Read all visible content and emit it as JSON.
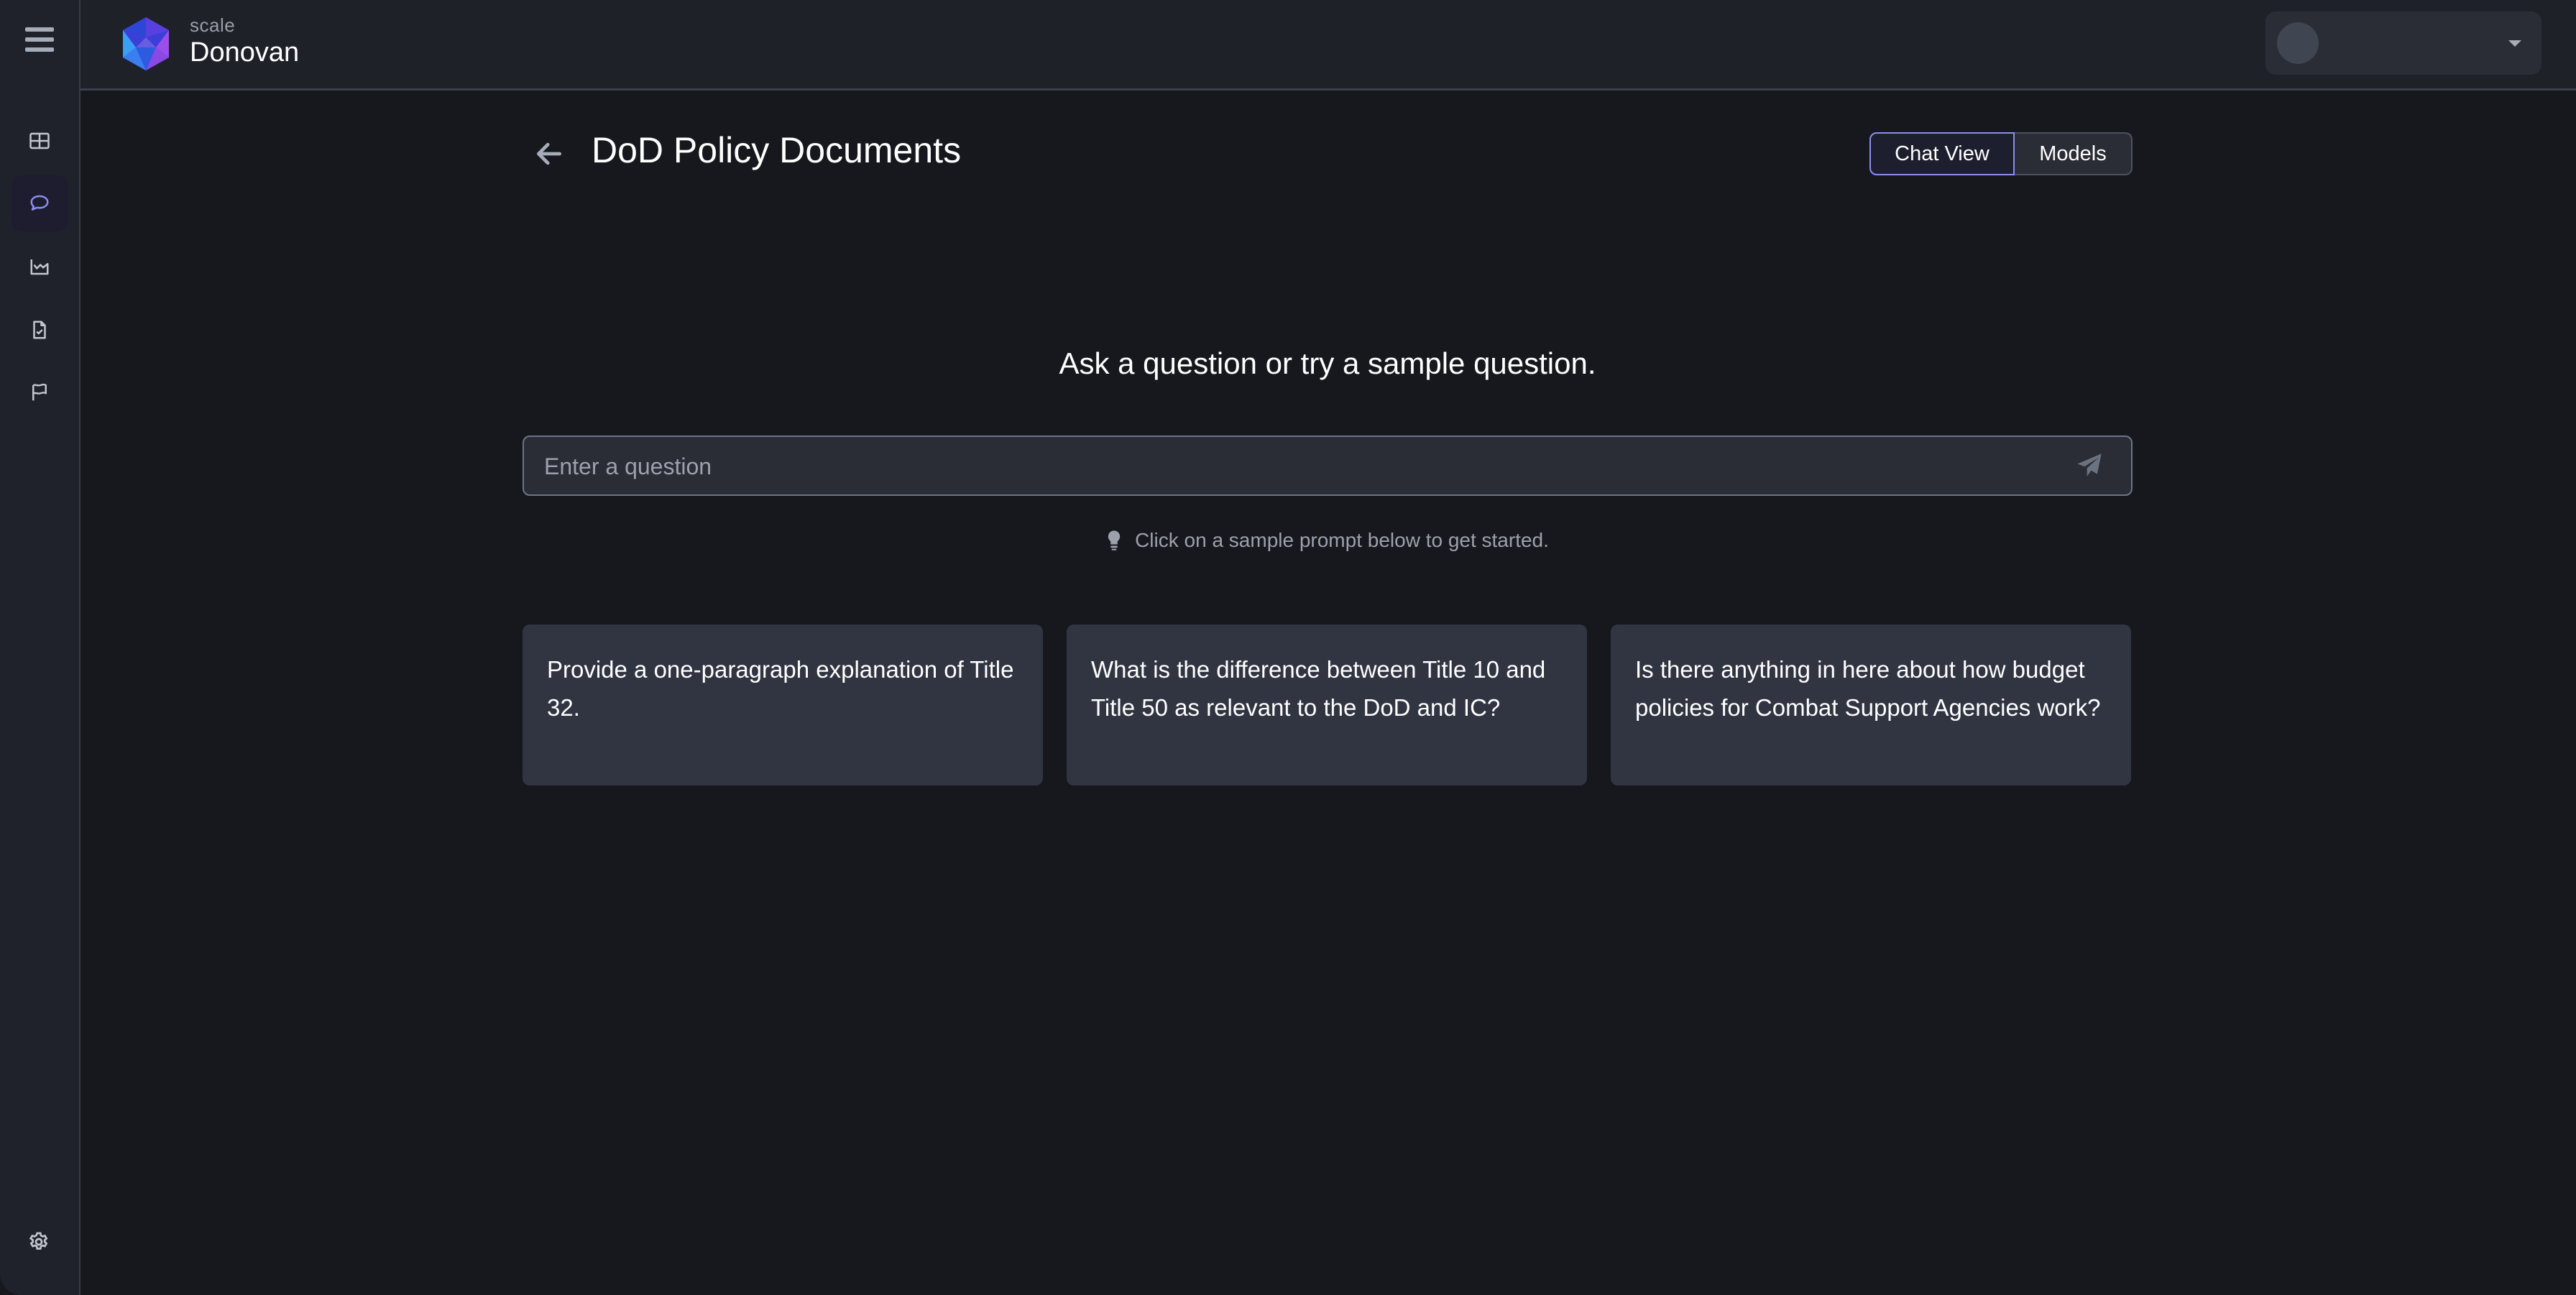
{
  "app": {
    "brand_small": "scale",
    "brand_name": "Donovan"
  },
  "sidebar": {
    "items": [
      {
        "name": "dashboard",
        "icon": "table-grid-icon",
        "active": false
      },
      {
        "name": "chat",
        "icon": "chat-bubble-icon",
        "active": true
      },
      {
        "name": "analytics",
        "icon": "area-chart-icon",
        "active": false
      },
      {
        "name": "documents",
        "icon": "file-check-icon",
        "active": false
      },
      {
        "name": "reports",
        "icon": "flag-icon",
        "active": false
      }
    ],
    "settings_icon": "gear-icon"
  },
  "header": {
    "user_menu_icon": "caret-down-icon"
  },
  "main": {
    "title": "DoD Policy Documents",
    "view_toggle": {
      "chat_view_label": "Chat View",
      "models_label": "Models",
      "active": "Chat View"
    },
    "prompt_heading": "Ask a question or try a sample question.",
    "question_input": {
      "value": "",
      "placeholder": "Enter a question"
    },
    "hint": "Click on a sample prompt below to get started.",
    "sample_prompts": [
      "Provide a one-paragraph explanation of Title 32.",
      "What is the difference between Title 10 and Title 50 as relevant to the DoD and IC?",
      "Is there anything in here about how budget policies for Combat Support Agencies work?"
    ]
  },
  "colors": {
    "accent": "#8b8ef0",
    "background": "#17181d",
    "sidebar_bg": "#1f222a",
    "card_bg": "#313542"
  }
}
